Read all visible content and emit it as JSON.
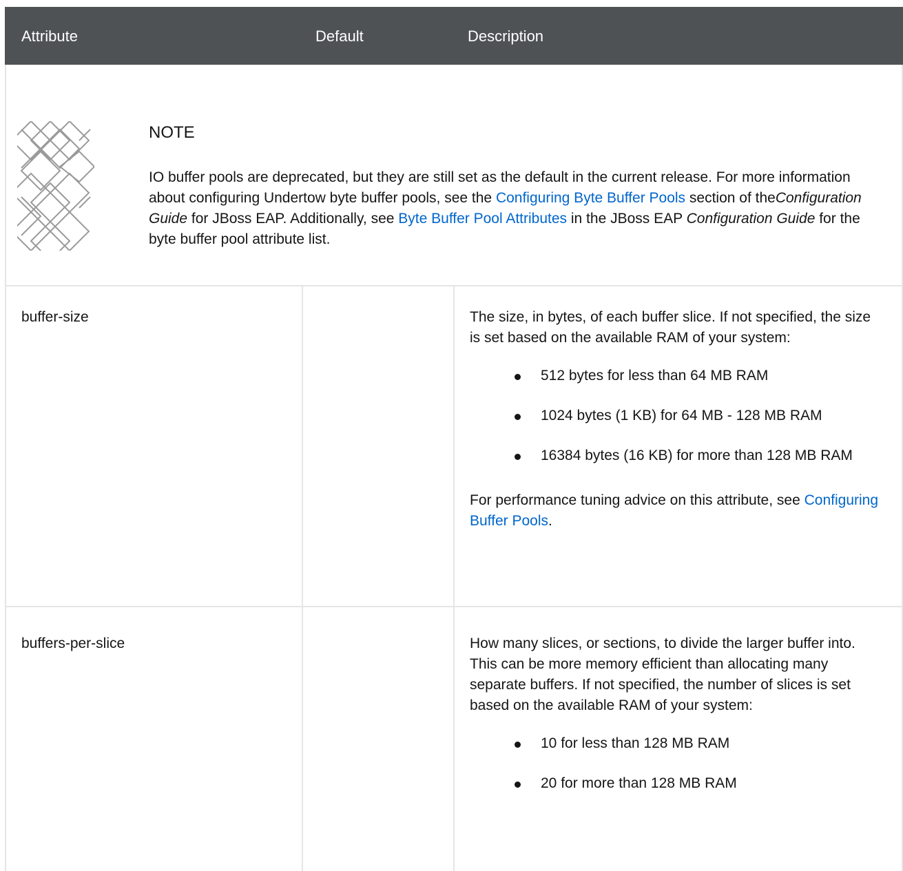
{
  "table": {
    "headers": [
      "Attribute",
      "Default",
      "Description"
    ],
    "note": {
      "title": "NOTE",
      "segments": [
        {
          "text": "IO buffer pools are deprecated, but they are still set as the default in the current release. For more information about configuring Undertow byte buffer pools, see the ",
          "style": "plain"
        },
        {
          "text": "Configuring Byte Buffer Pools",
          "style": "link"
        },
        {
          "text": " section of the",
          "style": "plain"
        },
        {
          "text": "Configuration Guide",
          "style": "italic"
        },
        {
          "text": " for JBoss EAP. Additionally, see ",
          "style": "plain"
        },
        {
          "text": "Byte Buffer Pool Attributes",
          "style": "link"
        },
        {
          "text": " in the JBoss EAP ",
          "style": "plain"
        },
        {
          "text": "Configuration Guide",
          "style": "italic"
        },
        {
          "text": " for the byte buffer pool attribute list.",
          "style": "plain"
        }
      ]
    },
    "rows": [
      {
        "attribute": "buffer-size",
        "default": "",
        "intro": "The size, in bytes, of each buffer slice. If not specified, the size is set based on the available RAM of your system:",
        "bullets": [
          "512 bytes for less than 64 MB RAM",
          "1024 bytes (1 KB) for 64 MB - 128 MB RAM",
          "16384 bytes (16 KB) for more than 128 MB RAM"
        ],
        "after_text": "For performance tuning advice on this attribute, see ",
        "after_link": "Configuring Buffer Pools",
        "after_end": "."
      },
      {
        "attribute": "buffers-per-slice",
        "default": "",
        "intro": "How many slices, or sections, to divide the larger buffer into. This can be more memory efficient than allocating many separate buffers. If not specified, the number of slices is set based on the available RAM of your system:",
        "bullets": [
          "10 for less than 128 MB RAM",
          "20 for more than 128 MB RAM"
        ]
      }
    ]
  },
  "colors": {
    "header_bg": "#4f5255",
    "link": "#0066cc",
    "border": "#e5e5e5",
    "text": "#151515"
  },
  "icons": [
    "note-pattern-icon",
    "bullet-dot-icon"
  ]
}
